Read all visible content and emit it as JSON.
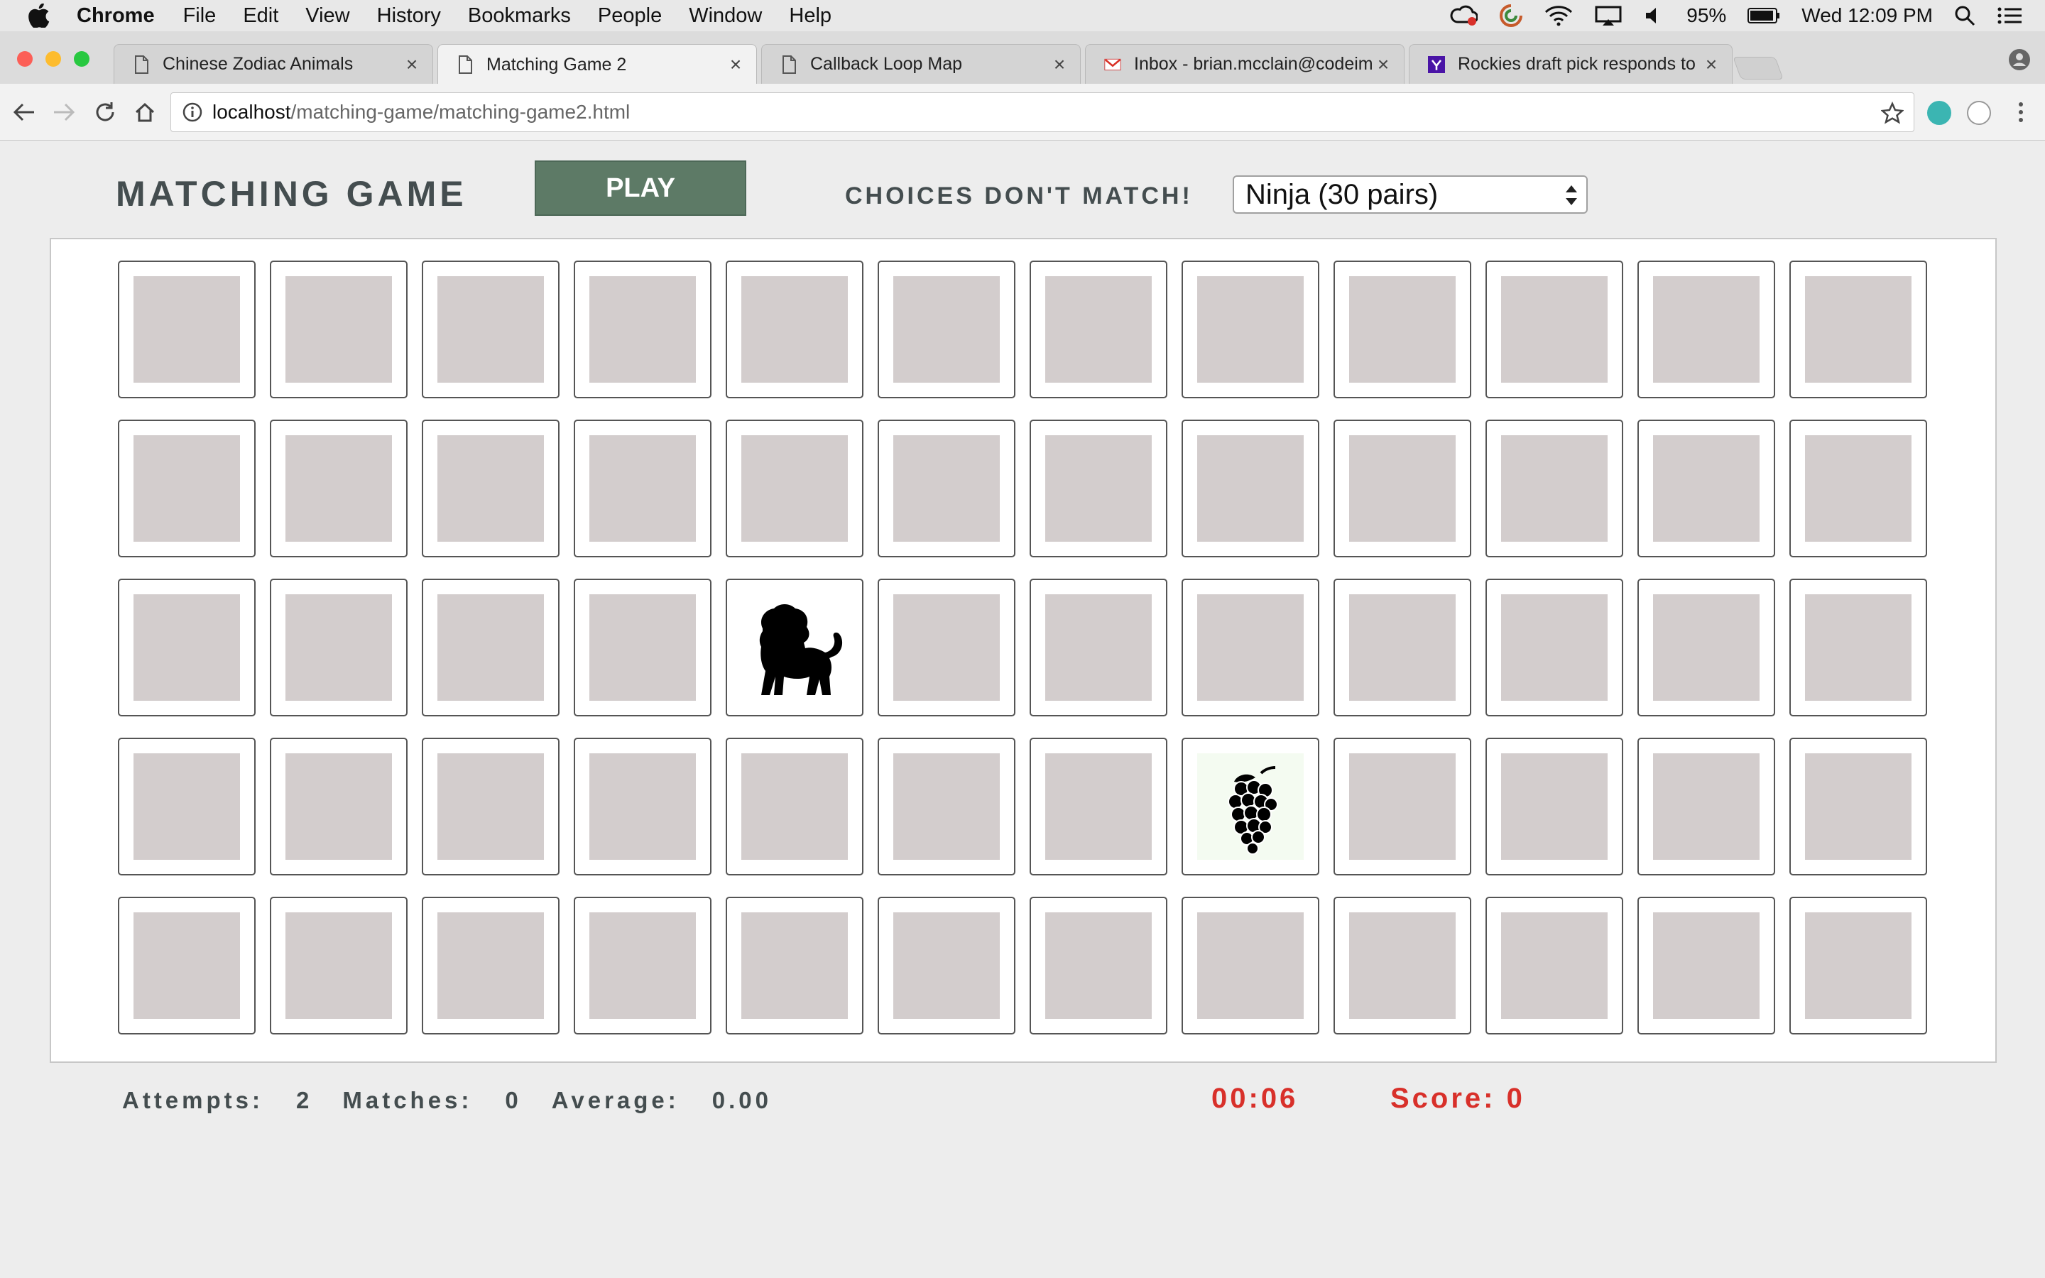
{
  "menubar": {
    "app_name": "Chrome",
    "items": [
      "File",
      "Edit",
      "View",
      "History",
      "Bookmarks",
      "People",
      "Window",
      "Help"
    ],
    "battery": "95%",
    "clock": "Wed 12:09 PM"
  },
  "tabs": [
    {
      "title": "Chinese Zodiac Animals",
      "icon": "page-icon",
      "active": false
    },
    {
      "title": "Matching Game 2",
      "icon": "page-icon",
      "active": true
    },
    {
      "title": "Callback Loop Map",
      "icon": "page-icon",
      "active": false
    },
    {
      "title": "Inbox - brian.mcclain@codeim",
      "icon": "gmail-icon",
      "active": false
    },
    {
      "title": "Rockies draft pick responds to",
      "icon": "yahoo-icon",
      "active": false
    }
  ],
  "address_bar": {
    "host": "localhost",
    "path": "/matching-game/matching-game2.html"
  },
  "game": {
    "title": "MATCHING GAME",
    "play_label": "PLAY",
    "status_message": "CHOICES DON'T MATCH!",
    "difficulty_selected": "Ninja (30 pairs)",
    "grid": {
      "rows": 5,
      "columns": 12
    },
    "revealed_cards": [
      {
        "row": 3,
        "column": 5,
        "image": "lion-silhouette"
      },
      {
        "row": 4,
        "column": 8,
        "image": "grapes-silhouette"
      }
    ]
  },
  "stats": {
    "attempts_label": "Attempts:",
    "attempts_value": "2",
    "matches_label": "Matches:",
    "matches_value": "0",
    "average_label": "Average:",
    "average_value": "0.00",
    "timer": "00:06",
    "score": "Score: 0"
  },
  "colors": {
    "play_button": "#5d7a66",
    "card_back": "#d3cdcd",
    "alert_red": "#d8302a",
    "heading_text": "#444d4f"
  }
}
